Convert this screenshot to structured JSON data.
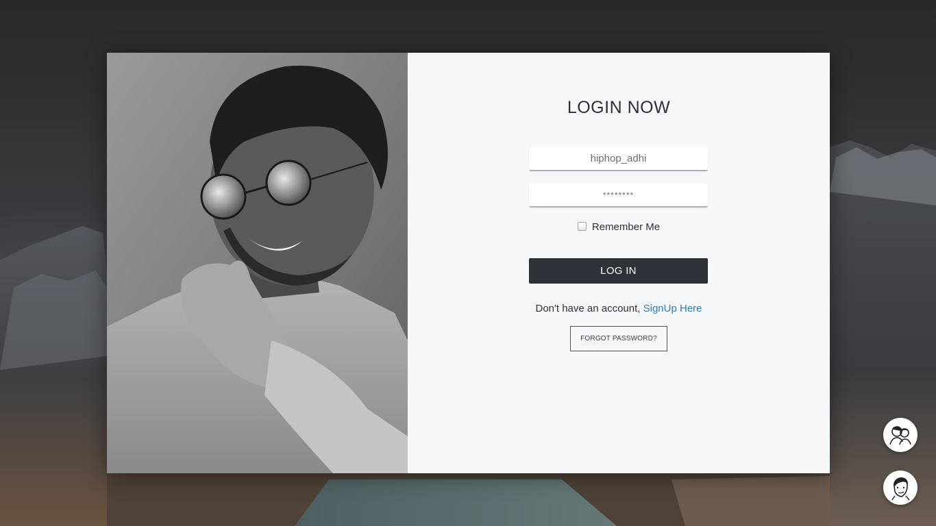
{
  "login": {
    "title": "LOGIN NOW",
    "username_value": "hiphop_adhi",
    "password_value": "********",
    "remember_label": "Remember Me",
    "login_button": "LOG IN",
    "signup_prompt": "Don't have an account, ",
    "signup_link": "SignUp Here",
    "forgot_button": "FORGOT PASSWORD?"
  },
  "colors": {
    "panel_bg": "#f6f7f9",
    "button_dark": "#2e3239",
    "link_blue": "#2a7db8"
  },
  "floating_buttons": [
    {
      "icon": "two-people-avatar-icon"
    },
    {
      "icon": "user-avatar-icon"
    }
  ]
}
